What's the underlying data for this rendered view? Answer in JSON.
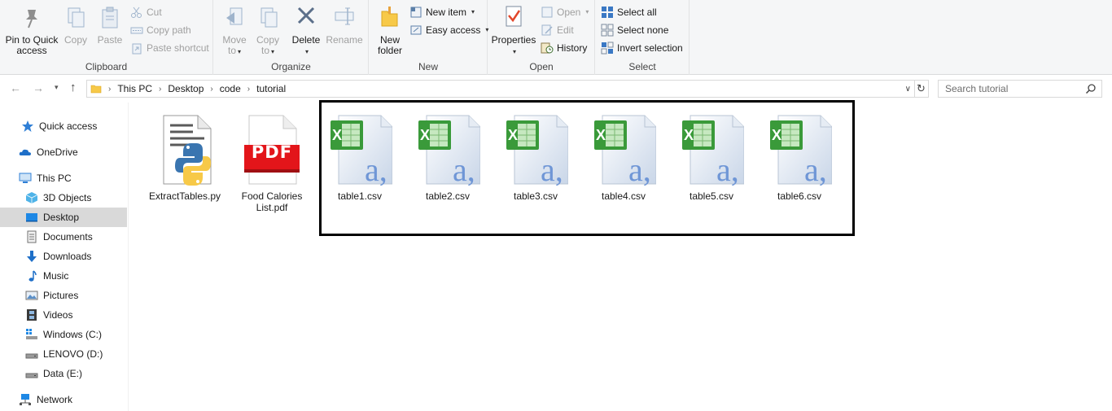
{
  "ribbon": {
    "clipboard": {
      "group_label": "Clipboard",
      "pin_label_1": "Pin to Quick",
      "pin_label_2": "access",
      "copy_label": "Copy",
      "paste_label": "Paste",
      "cut_label": "Cut",
      "copy_path_label": "Copy path",
      "paste_shortcut_label": "Paste shortcut"
    },
    "organize": {
      "group_label": "Organize",
      "move_to_1": "Move",
      "move_to_2": "to",
      "copy_to_1": "Copy",
      "copy_to_2": "to",
      "delete_label": "Delete",
      "rename_label": "Rename"
    },
    "new": {
      "group_label": "New",
      "new_folder_1": "New",
      "new_folder_2": "folder",
      "new_item_label": "New item",
      "easy_access_label": "Easy access"
    },
    "open": {
      "group_label": "Open",
      "properties_label": "Properties",
      "open_label": "Open",
      "edit_label": "Edit",
      "history_label": "History"
    },
    "select": {
      "group_label": "Select",
      "select_all_label": "Select all",
      "select_none_label": "Select none",
      "invert_selection_label": "Invert selection"
    }
  },
  "address_bar": {
    "breadcrumbs": [
      "This PC",
      "Desktop",
      "code",
      "tutorial"
    ],
    "search_placeholder": "Search tutorial"
  },
  "sidebar": {
    "items": [
      {
        "label": "Quick access",
        "icon": "star-icon"
      },
      {
        "label": "OneDrive",
        "icon": "cloud-icon"
      },
      {
        "label": "This PC",
        "icon": "computer-icon"
      },
      {
        "label": "3D Objects",
        "icon": "cube-icon"
      },
      {
        "label": "Desktop",
        "icon": "desktop-icon",
        "selected": true
      },
      {
        "label": "Documents",
        "icon": "document-icon"
      },
      {
        "label": "Downloads",
        "icon": "download-arrow-icon"
      },
      {
        "label": "Music",
        "icon": "music-note-icon"
      },
      {
        "label": "Pictures",
        "icon": "picture-icon"
      },
      {
        "label": "Videos",
        "icon": "film-icon"
      },
      {
        "label": "Windows (C:)",
        "icon": "drive-icon"
      },
      {
        "label": "LENOVO (D:)",
        "icon": "drive-icon"
      },
      {
        "label": "Data (E:)",
        "icon": "drive-icon"
      },
      {
        "label": "Network",
        "icon": "network-icon"
      }
    ]
  },
  "files": [
    {
      "name": "ExtractTables.py",
      "icon": "python-file-icon"
    },
    {
      "name_1": "Food Calories",
      "name_2": "List.pdf",
      "icon": "pdf-file-icon"
    },
    {
      "name": "table1.csv",
      "icon": "excel-csv-file-icon"
    },
    {
      "name": "table2.csv",
      "icon": "excel-csv-file-icon"
    },
    {
      "name": "table3.csv",
      "icon": "excel-csv-file-icon"
    },
    {
      "name": "table4.csv",
      "icon": "excel-csv-file-icon"
    },
    {
      "name": "table5.csv",
      "icon": "excel-csv-file-icon"
    },
    {
      "name": "table6.csv",
      "icon": "excel-csv-file-icon"
    }
  ],
  "pdf_badge_text": "PDF",
  "colors": {
    "selected_bg": "#d9d9d9",
    "excel_green": "#1f7a3a",
    "pdf_red": "#e3151a",
    "highlight_border": "#000000"
  }
}
